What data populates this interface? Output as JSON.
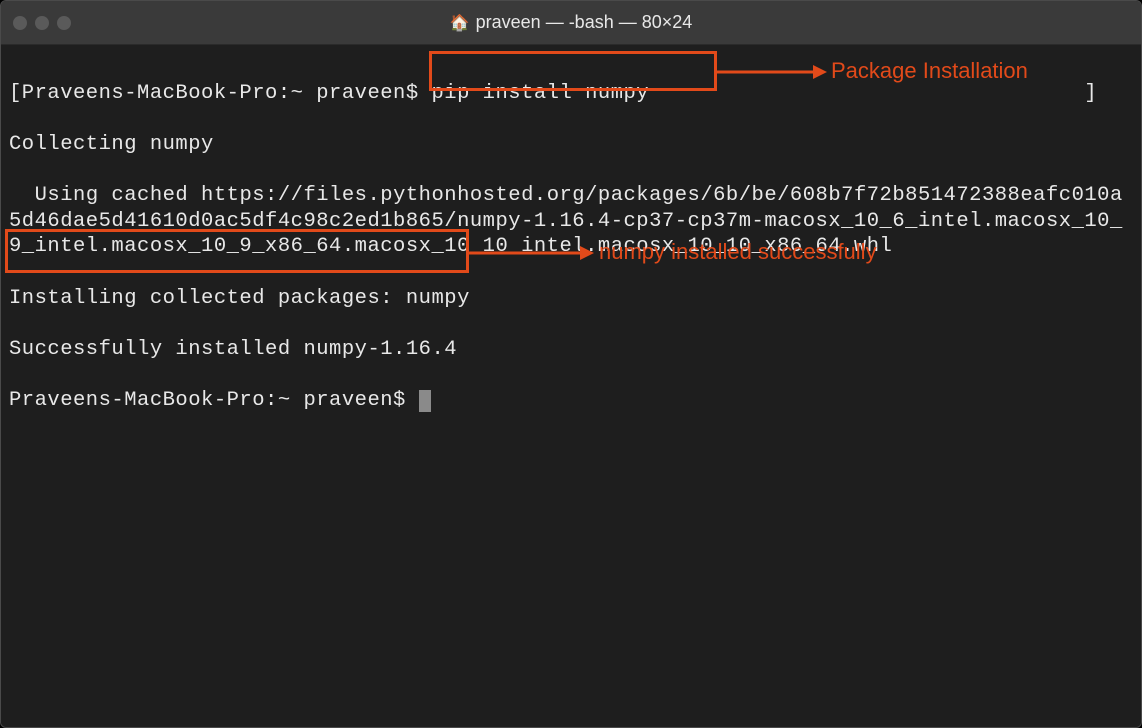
{
  "window": {
    "title": "praveen — -bash — 80×24",
    "home_icon": "🏠"
  },
  "terminal": {
    "prompt1_prefix": "[Praveens-MacBook-Pro:~ praveen$ ",
    "command": "pip install numpy",
    "prompt1_suffix": "                                  ]",
    "line_collecting": "Collecting numpy",
    "line_cached": "  Using cached https://files.pythonhosted.org/packages/6b/be/608b7f72b851472388eafc010a5d46dae5d41610d0ac5df4c98c2ed1b865/numpy-1.16.4-cp37-cp37m-macosx_10_6_intel.macosx_10_9_intel.macosx_10_9_x86_64.macosx_10_10_intel.macosx_10_10_x86_64.whl",
    "line_installing": "Installing collected packages: numpy",
    "line_success": "Successfully installed numpy-1.16.4",
    "prompt2": "Praveens-MacBook-Pro:~ praveen$ "
  },
  "annotations": {
    "label1": "Package Installation",
    "label2": "numpy installed successfully"
  },
  "colors": {
    "highlight": "#e24a1a",
    "bg": "#1e1e1e",
    "fg": "#e8e8e8"
  }
}
